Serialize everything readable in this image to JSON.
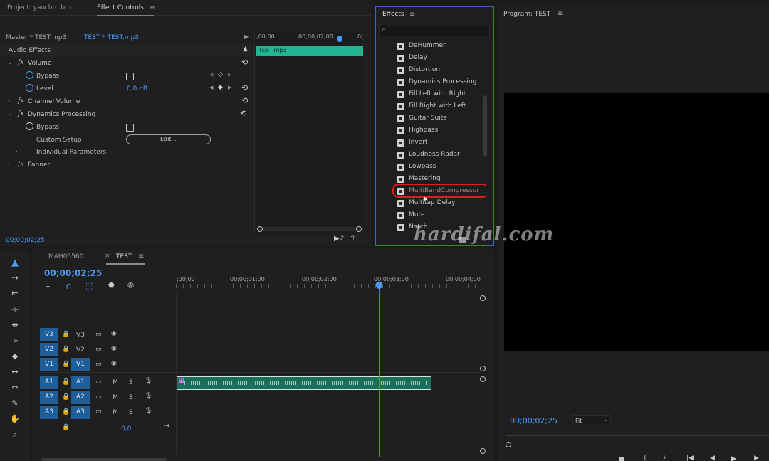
{
  "effect_controls": {
    "tab_project": "Project: yaw bro bro",
    "tab_effect_controls": "Effect Controls",
    "master_label": "Master * TEST.mp3",
    "clip_label": "TEST * TEST.mp3",
    "section_audio_effects": "Audio Effects",
    "rows": {
      "volume": "Volume",
      "bypass1": "Bypass",
      "level": "Level",
      "level_value": "0,0 dB",
      "channel_volume": "Channel Volume",
      "dynamics_processing": "Dynamics Processing",
      "bypass2": "Bypass",
      "custom_setup": "Custom Setup",
      "edit_button": "Edit...",
      "individual_parameters": "Individual Parameters",
      "panner": "Panner"
    },
    "fx_label": "fx",
    "mini_ruler_start": ";00;00",
    "mini_ruler_mid": "00;00;02;00",
    "mini_ruler_end": "0(",
    "clip_name": "TEST.mp3",
    "timecode": "00;00;02;25"
  },
  "effects_panel": {
    "title": "Effects",
    "search_placeholder": "",
    "items": [
      "DeHummer",
      "Delay",
      "Distortion",
      "Dynamics Processing",
      "Fill Left with Right",
      "Fill Right with Left",
      "Guitar Suite",
      "Highpass",
      "Invert",
      "Loudness Radar",
      "Lowpass",
      "Mastering",
      "MultiBandCompressor",
      "Multitap Delay",
      "Mute",
      "Notch"
    ],
    "highlighted_item": "MultiBandCompressor",
    "highlight_color": "#e21b1b"
  },
  "program_monitor": {
    "title": "Program: TEST",
    "timecode": "00;00;02;25",
    "fit_label": "Fit"
  },
  "timeline": {
    "tab_other": "MAH05560",
    "tab_active": "TEST",
    "timecode": "00;00;02;25",
    "ruler": [
      ";00;00",
      "00;00;01;00",
      "00;00;02;00",
      "00;00;03;00",
      "00;00;04;00"
    ],
    "video_tracks": [
      {
        "src": "V3",
        "dst": "V3"
      },
      {
        "src": "V2",
        "dst": "V2"
      },
      {
        "src": "V1",
        "dst": "V1"
      }
    ],
    "audio_tracks": [
      {
        "src": "A1",
        "dst": "A1"
      },
      {
        "src": "A2",
        "dst": "A2"
      },
      {
        "src": "A3",
        "dst": "A3"
      }
    ],
    "mute_label": "M",
    "solo_label": "S",
    "master_value": "0,0",
    "accent_color": "#4a9bff",
    "track_btn_color": "#1f5e96",
    "clip_color": "#1fb595"
  },
  "watermark": "hardifal.com"
}
